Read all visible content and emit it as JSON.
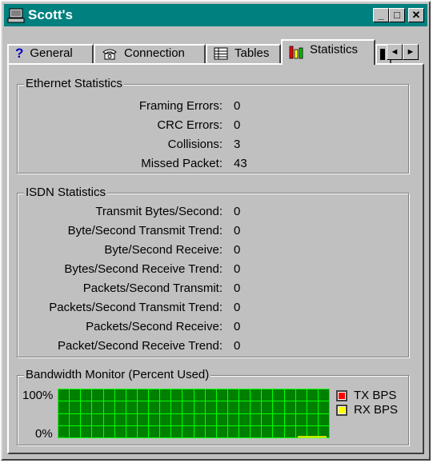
{
  "window": {
    "title": "Scott's"
  },
  "titlebar_buttons": {
    "minimize": "_",
    "maximize": "□",
    "close": "✕"
  },
  "tabs": [
    {
      "label": "General",
      "icon": "help-icon"
    },
    {
      "label": "Connection",
      "icon": "phone-icon"
    },
    {
      "label": "Tables",
      "icon": "table-icon"
    },
    {
      "label": "Statistics",
      "icon": "bar-chart-icon",
      "active": true
    }
  ],
  "tab_scroll": {
    "left": "◄",
    "right": "►"
  },
  "ethernet": {
    "title": "Ethernet Statistics",
    "rows": [
      {
        "label": "Framing Errors:",
        "value": "0"
      },
      {
        "label": "CRC Errors:",
        "value": "0"
      },
      {
        "label": "Collisions:",
        "value": "3"
      },
      {
        "label": "Missed Packet:",
        "value": "43"
      }
    ]
  },
  "isdn": {
    "title": "ISDN Statistics",
    "rows": [
      {
        "label": "Transmit Bytes/Second:",
        "value": "0"
      },
      {
        "label": "Byte/Second Transmit Trend:",
        "value": "0"
      },
      {
        "label": "Byte/Second Receive:",
        "value": "0"
      },
      {
        "label": "Bytes/Second Receive Trend:",
        "value": "0"
      },
      {
        "label": "Packets/Second Transmit:",
        "value": "0"
      },
      {
        "label": "Packets/Second Transmit Trend:",
        "value": "0"
      },
      {
        "label": "Packets/Second Receive:",
        "value": "0"
      },
      {
        "label": "Packet/Second Receive Trend:",
        "value": "0"
      }
    ]
  },
  "bandwidth": {
    "title": "Bandwidth Monitor (Percent Used)",
    "y_top": "100%",
    "y_bottom": "0%",
    "legend": [
      {
        "label": "TX BPS",
        "color": "#ff0000"
      },
      {
        "label": "RX BPS",
        "color": "#ffff00"
      }
    ],
    "grid_color": "#00ff00",
    "background": "#008000",
    "rx_level_percent": 1
  }
}
